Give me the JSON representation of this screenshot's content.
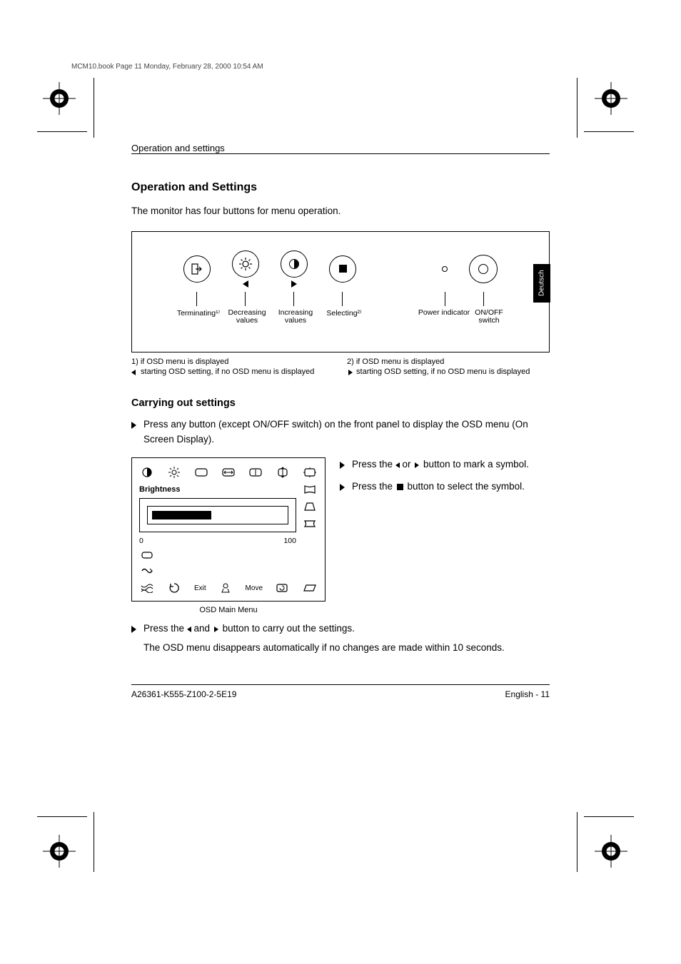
{
  "run_head_top": "MCM10.book  Page 11  Monday, February 28, 2000  10:54 AM",
  "header": {
    "left": "Operation and settings",
    "right": ""
  },
  "side_tab": "Deutsch",
  "section_title": "Operation and Settings",
  "intro": "The monitor has four buttons for menu operation.",
  "panel": {
    "buttons": [
      "EXIT",
      "brightness-icon",
      "contrast-icon",
      "select-icon"
    ],
    "led_label": "Power indicator",
    "switch_label": "ON/OFF switch",
    "labels": {
      "exit": "Terminating¹⁾",
      "decrease": "Decreasing values",
      "increase": "Increasing values",
      "select": "Selecting²⁾",
      "led": "Power indicator",
      "on_off": "ON/OFF switch"
    },
    "footnotes": {
      "f1a": "1) if OSD menu is displayed",
      "f1b": " starting OSD setting, if no OSD menu is displayed",
      "f2a": "2) if OSD menu is displayed",
      "f2b": " starting OSD setting, if no OSD menu is displayed"
    }
  },
  "subsection_title": "Carrying out settings",
  "steps": {
    "s1": "Press any button (except ON/OFF switch) on the front panel to display the OSD menu (On Screen Display).",
    "s2_pre": "Press the ",
    "s2_mid": " or ",
    "s2_post": " button to mark a symbol.",
    "s3_pre": "Press the ",
    "s3_post": " button to select the symbol.",
    "s4_pre": "Press the ",
    "s4_mid": " and ",
    "s4_post": " button to carry out the settings.",
    "s4_tail": "The OSD menu disappears automatically if no changes are made within 10 seconds."
  },
  "osd": {
    "title": "Brightness",
    "bar_min": "0",
    "bar_max": "100",
    "bottom_exit": "Exit",
    "bottom_move": "Move",
    "caption": "OSD Main Menu"
  },
  "footer": {
    "left": "A26361-K555-Z100-2-5E19",
    "right": "English - 11"
  }
}
